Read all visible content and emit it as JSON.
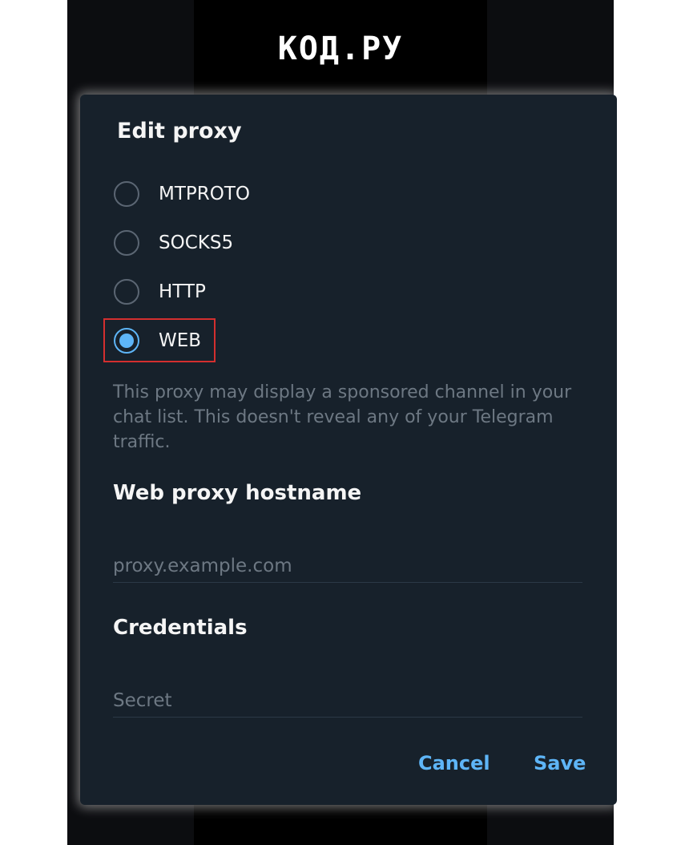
{
  "watermark": {
    "text": "КОД.РУ"
  },
  "dialog": {
    "title": "Edit proxy",
    "proxy_types": [
      {
        "label": "MTPROTO",
        "selected": false
      },
      {
        "label": "SOCKS5",
        "selected": false
      },
      {
        "label": "HTTP",
        "selected": false
      },
      {
        "label": "WEB",
        "selected": true
      }
    ],
    "note": "This proxy may display a sponsored channel in your chat list. This doesn't reveal any of your Telegram traffic.",
    "hostname_section": {
      "title": "Web proxy hostname",
      "placeholder": "proxy.example.com",
      "value": ""
    },
    "credentials_section": {
      "title": "Credentials",
      "placeholder": "Secret",
      "value": ""
    },
    "buttons": {
      "cancel": "Cancel",
      "save": "Save"
    }
  },
  "colors": {
    "dialog_bg": "#17212b",
    "accent": "#5eb5f7",
    "muted_text": "#6d7883",
    "highlight_border": "#d32f2f"
  }
}
